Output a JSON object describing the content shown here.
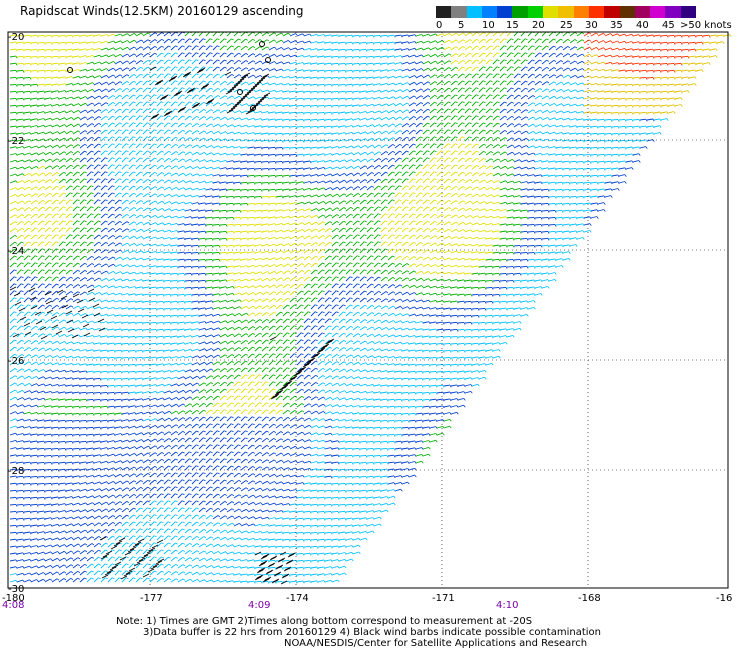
{
  "title": "Rapidscat Winds(12.5KM) 20160129 ascending",
  "colorbar": {
    "colors": [
      "#202020",
      "#808080",
      "#00c0ff",
      "#0080ff",
      "#0040d0",
      "#00a000",
      "#00d000",
      "#e0e000",
      "#f0c000",
      "#ff8000",
      "#ff3000",
      "#c00000",
      "#603000",
      "#a00060",
      "#d000d0",
      "#8000c0",
      "#300080"
    ],
    "labels": [
      "0",
      "5",
      "10",
      "15",
      "20",
      "25",
      "30",
      "35",
      "40",
      "45",
      ">50 knots"
    ]
  },
  "axes": {
    "lat_labels": [
      "-20",
      "-22",
      "-24",
      "-26",
      "-28",
      "-30"
    ],
    "lon_labels": [
      "-180",
      "-177",
      "-174",
      "-171",
      "-168",
      "-16"
    ],
    "time_labels": [
      "4:08",
      "4:09",
      "4:10"
    ]
  },
  "notes": {
    "line1": "Note: 1) Times are GMT 2)Times along bottom correspond to measurement at -20S",
    "line2": "3)Data buffer is 22 hrs from 20160129 4) Black wind barbs indicate possible contamination",
    "line3": "NOAA/NESDIS/Center for Satellite Applications and Research"
  },
  "map": {
    "swath_color_low": "#00c0ff",
    "swath_color_mid": "#0040d0",
    "swath_color_green": "#00b000",
    "swath_color_high": "#ff3000",
    "land_color": "#000000"
  }
}
